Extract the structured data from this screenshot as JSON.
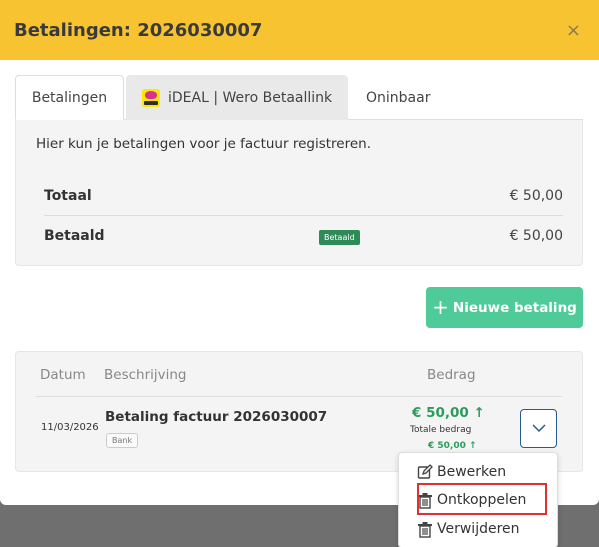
{
  "modal": {
    "title": "Betalingen: 2026030007",
    "close_symbol": "×"
  },
  "tabs": [
    {
      "label": "Betalingen"
    },
    {
      "label": "iDEAL | Wero Betaallink"
    },
    {
      "label": "Oninbaar"
    }
  ],
  "panel": {
    "intro": "Hier kun je betalingen voor je factuur registreren.",
    "total_label": "Totaal",
    "total_value": "€ 50,00",
    "paid_label": "Betaald",
    "paid_badge": "Betaald",
    "paid_value": "€ 50,00"
  },
  "new_payment_button": "Nieuwe betaling",
  "table": {
    "headers": [
      "Datum",
      "Beschrijving",
      "Bedrag"
    ],
    "rows": [
      {
        "date": "11/03/2026",
        "title": "Betaling factuur 2026030007",
        "badge": "Bank",
        "amount": "€ 50,00 ↑",
        "amount_label": "Totale bedrag",
        "amount_sub": "€ 50,00 ↑"
      }
    ]
  },
  "menu": {
    "items": [
      {
        "label": "Bewerken",
        "icon": "edit-icon"
      },
      {
        "label": "Ontkoppelen",
        "icon": "trash-icon"
      },
      {
        "label": "Verwijderen",
        "icon": "trash-icon"
      }
    ]
  },
  "colors": {
    "header": "#f7c331",
    "primary_button": "#4fcb9a",
    "paid_badge": "#2e8b57",
    "amount": "#2a9d5c",
    "highlight": "#dd3333"
  }
}
